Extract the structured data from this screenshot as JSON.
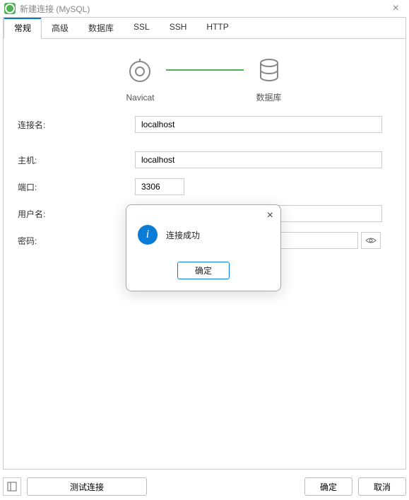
{
  "title": "新建连接 (MySQL)",
  "tabs": [
    {
      "label": "常规",
      "active": true
    },
    {
      "label": "高级",
      "active": false
    },
    {
      "label": "数据库",
      "active": false
    },
    {
      "label": "SSL",
      "active": false
    },
    {
      "label": "SSH",
      "active": false
    },
    {
      "label": "HTTP",
      "active": false
    }
  ],
  "diagram": {
    "left_label": "Navicat",
    "right_label": "数据库"
  },
  "form": {
    "connection_name": {
      "label": "连接名:",
      "value": "localhost"
    },
    "host": {
      "label": "主机:",
      "value": "localhost"
    },
    "port": {
      "label": "端口:",
      "value": "3306"
    },
    "username": {
      "label": "用户名:",
      "value": ""
    },
    "password": {
      "label": "密码:",
      "value": ""
    }
  },
  "footer": {
    "test_connection": "测试连接",
    "ok": "确定",
    "cancel": "取消"
  },
  "modal": {
    "message": "连接成功",
    "ok": "确定"
  }
}
